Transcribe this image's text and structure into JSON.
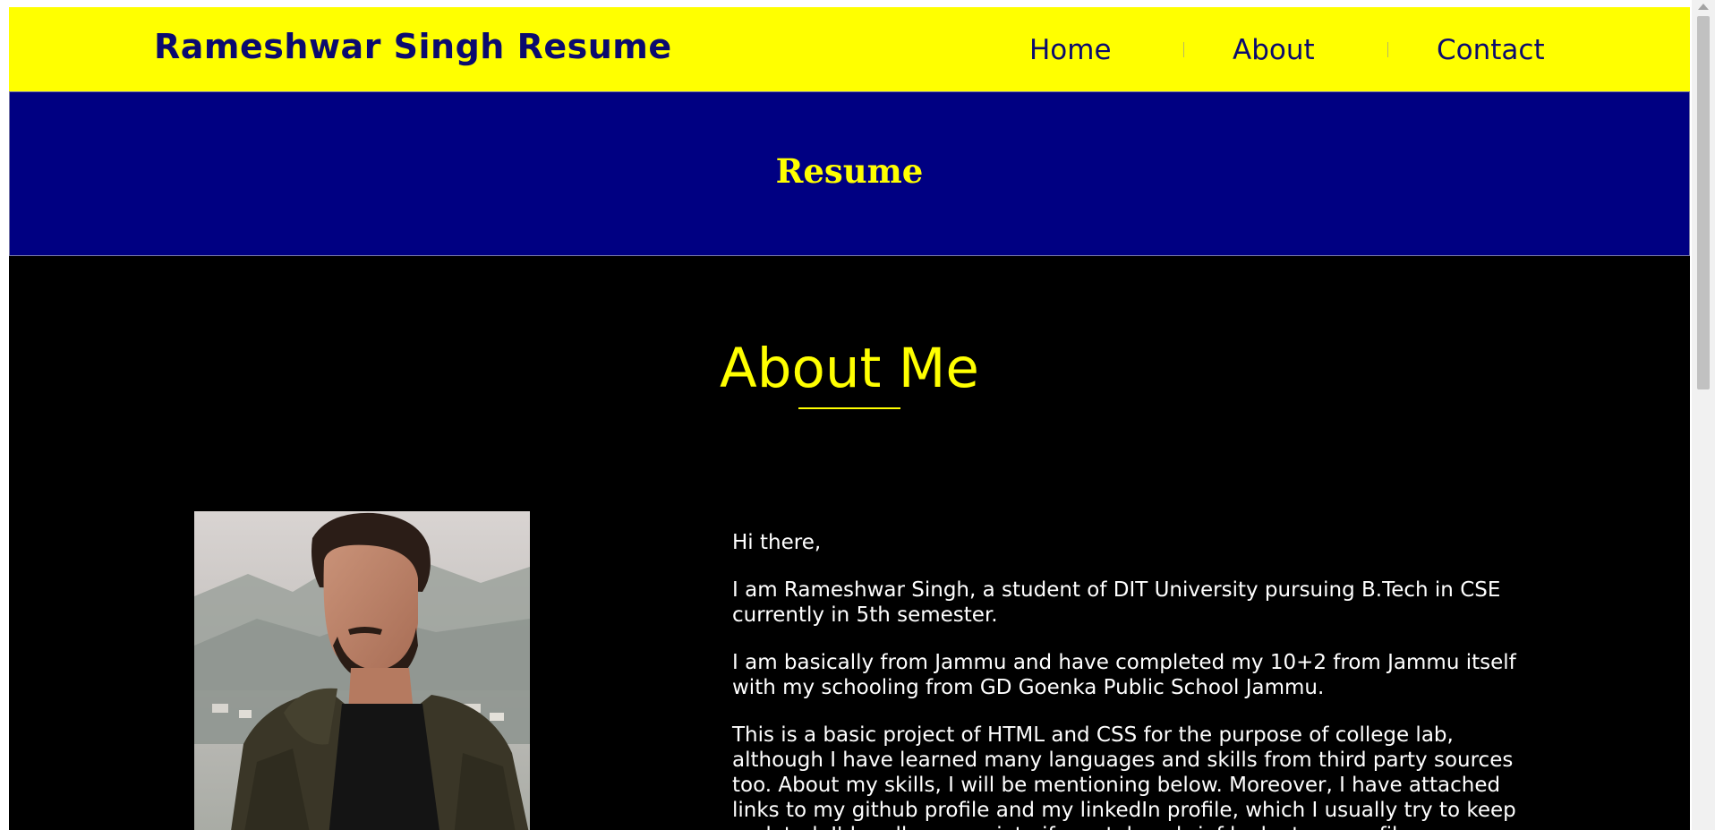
{
  "nav": {
    "brand": "Rameshwar Singh Resume",
    "links": [
      "Home",
      "About",
      "Contact"
    ]
  },
  "banner": {
    "title": "Resume"
  },
  "about": {
    "heading": "About Me",
    "paragraphs": [
      "Hi there,",
      "I am Rameshwar Singh, a student of DIT University pursuing B.Tech in CSE currently in 5th semester.",
      "I am basically from Jammu and have completed my 10+2 from Jammu itself with my schooling from GD Goenka Public School Jammu.",
      "This is a basic project of HTML and CSS for the purpose of college lab, although I have learned many languages and skills from third party sources too. About my skills, I will be mentioning below. Moreover, I have attached links to my github profile and my linkedIn profile, which I usually try to keep updated. I'd really appreciate if you take a brief look at my profiles."
    ]
  },
  "colors": {
    "accent": "#ffff00",
    "brand_text": "#0b0b6e",
    "banner_bg": "#000082",
    "body_bg": "#000000"
  }
}
